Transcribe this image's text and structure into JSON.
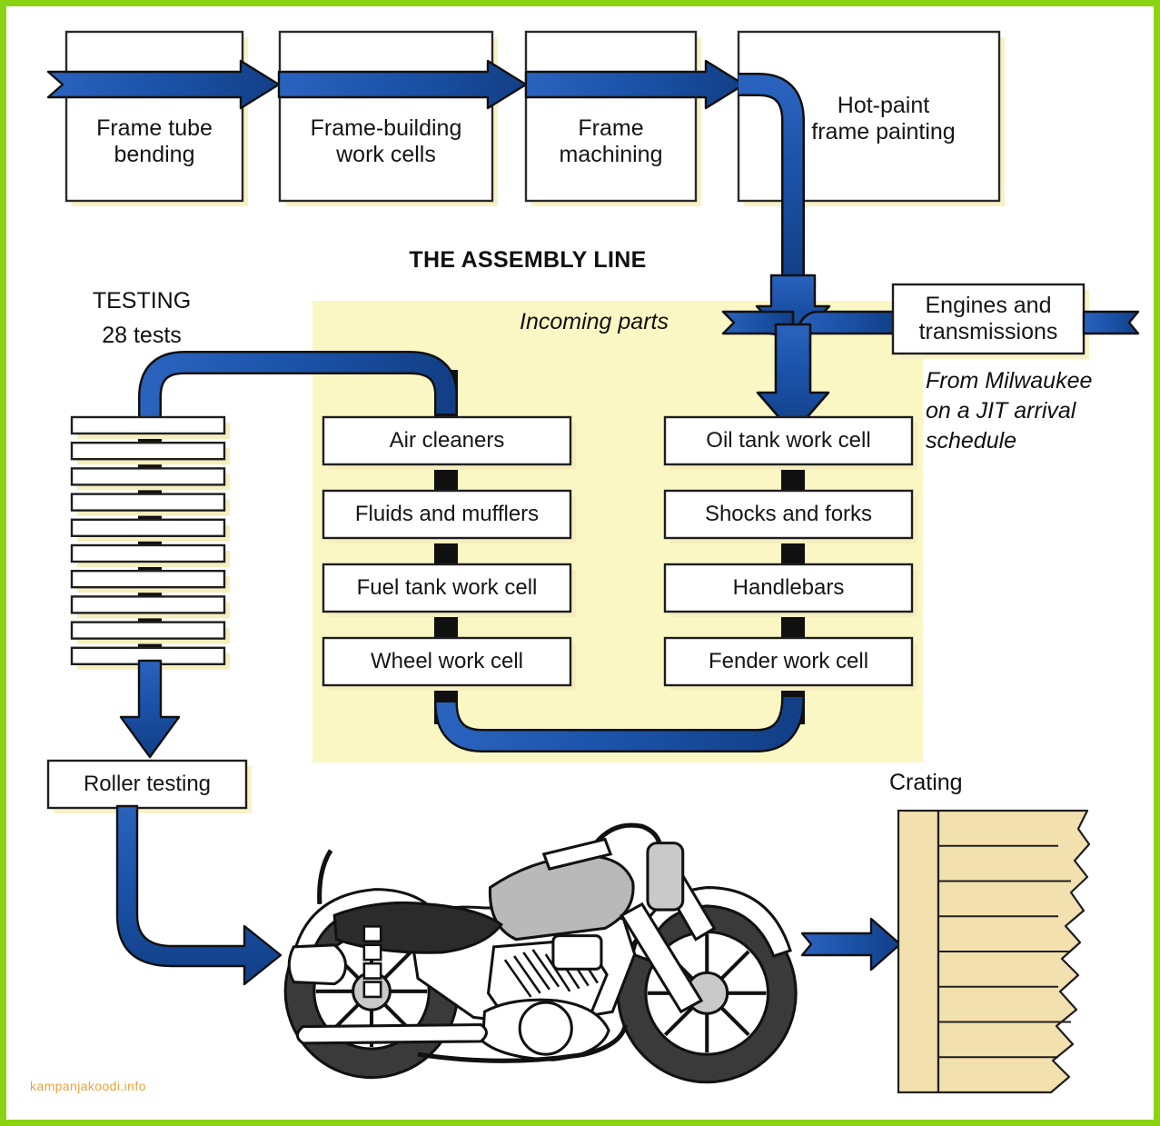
{
  "diagram": {
    "title": "THE ASSEMBLY LINE",
    "watermark": "kampanjakoodi.info",
    "colors": {
      "arrow_blue": "#1B52A8",
      "arrow_blue_dark": "#123F86",
      "zone_yellow": "#FBF7C4",
      "box_shadow_yellow": "#F7F0C0",
      "crate_tan": "#F2E0AF",
      "border_green": "#8CD413",
      "outline": "#1A1A1A",
      "watermark_orange": "#E8A33D"
    },
    "frame_line": {
      "steps": [
        {
          "label": "Frame tube\nbending",
          "line1": "Frame tube",
          "line2": "bending"
        },
        {
          "label": "Frame-building\nwork cells",
          "line1": "Frame-building",
          "line2": "work cells"
        },
        {
          "label": "Frame\nmachining",
          "line1": "Frame",
          "line2": "machining"
        },
        {
          "label": "Hot-paint\nframe painting",
          "line1": "Hot-paint",
          "line2": "frame painting"
        }
      ]
    },
    "testing": {
      "heading": "TESTING",
      "subheading": "28 tests",
      "test_bar_count": 10,
      "roller_testing": "Roller testing"
    },
    "assembly": {
      "zone_title": "THE ASSEMBLY LINE",
      "incoming_parts": "Incoming parts",
      "left_column": [
        "Air cleaners",
        "Fluids and mufflers",
        "Fuel tank work cell",
        "Wheel work cell"
      ],
      "right_column": [
        "Oil tank work cell",
        "Shocks and forks",
        "Handlebars",
        "Fender work cell"
      ]
    },
    "engines": {
      "line1": "Engines and",
      "line2": "transmissions",
      "note_line1": "From Milwaukee",
      "note_line2": "on a JIT arrival",
      "note_line3": "schedule"
    },
    "crating": {
      "label": "Crating",
      "crate_slat_count": 7
    },
    "product": {
      "name": "motorcycle-illustration"
    }
  }
}
